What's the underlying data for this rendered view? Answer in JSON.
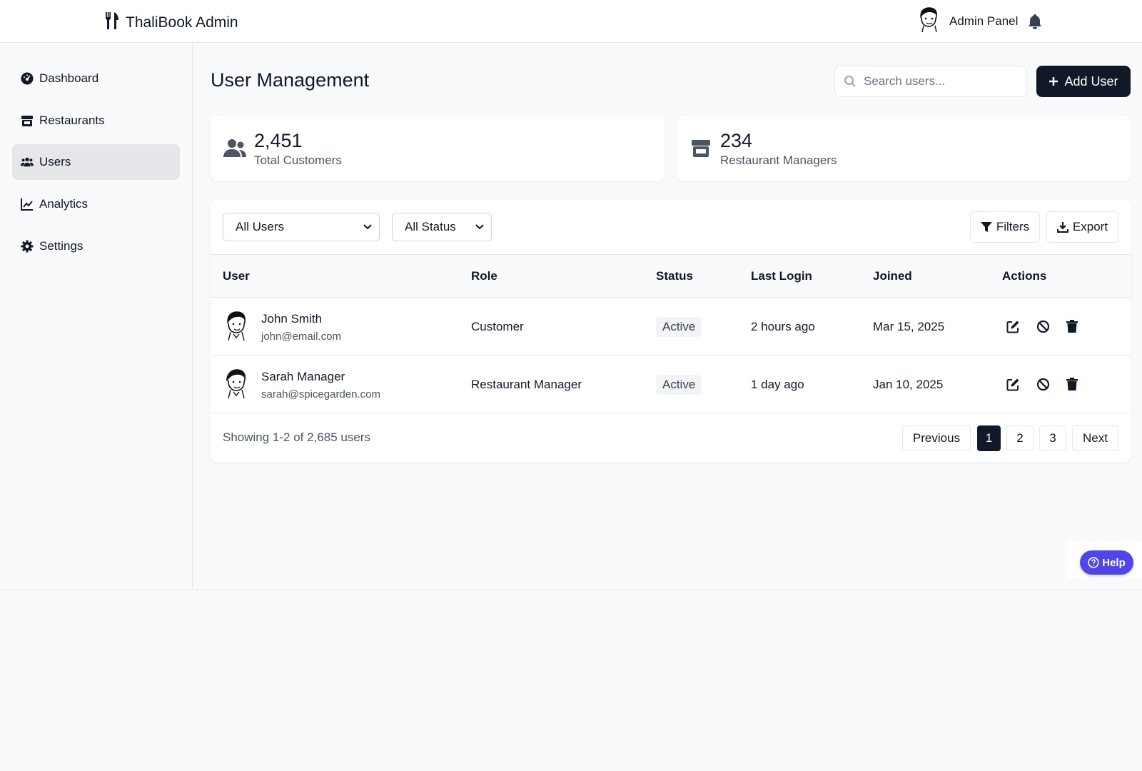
{
  "app": {
    "title": "ThaliBook Admin",
    "panel_label": "Admin Panel"
  },
  "sidebar": {
    "items": [
      {
        "label": "Dashboard",
        "icon": "dashboard-icon",
        "active": false
      },
      {
        "label": "Restaurants",
        "icon": "store-icon",
        "active": false
      },
      {
        "label": "Users",
        "icon": "users-icon",
        "active": true
      },
      {
        "label": "Analytics",
        "icon": "chart-line-icon",
        "active": false
      },
      {
        "label": "Settings",
        "icon": "gear-icon",
        "active": false
      }
    ]
  },
  "header": {
    "title": "User Management",
    "search_placeholder": "Search users...",
    "add_button": "Add User"
  },
  "stats": [
    {
      "value": "2,451",
      "label": "Total Customers",
      "icon": "users-icon"
    },
    {
      "value": "234",
      "label": "Restaurant Managers",
      "icon": "store-icon"
    }
  ],
  "filters": {
    "user_type": "All Users",
    "status": "All Status",
    "filters_button": "Filters",
    "export_button": "Export"
  },
  "table": {
    "columns": [
      "User",
      "Role",
      "Status",
      "Last Login",
      "Joined",
      "Actions"
    ],
    "rows": [
      {
        "name": "John Smith",
        "email": "john@email.com",
        "role": "Customer",
        "status": "Active",
        "last_login": "2 hours ago",
        "joined": "Mar 15, 2025"
      },
      {
        "name": "Sarah Manager",
        "email": "sarah@spicegarden.com",
        "role": "Restaurant Manager",
        "status": "Active",
        "last_login": "1 day ago",
        "joined": "Jan 10, 2025"
      }
    ]
  },
  "pagination": {
    "info": "Showing 1-2 of 2,685 users",
    "previous": "Previous",
    "pages": [
      "1",
      "2",
      "3"
    ],
    "current_page": "1",
    "next": "Next"
  },
  "help": {
    "label": "Help"
  },
  "colors": {
    "primary": "#111827",
    "help": "#4f46e5",
    "badge_bg": "#f3f4f6"
  }
}
